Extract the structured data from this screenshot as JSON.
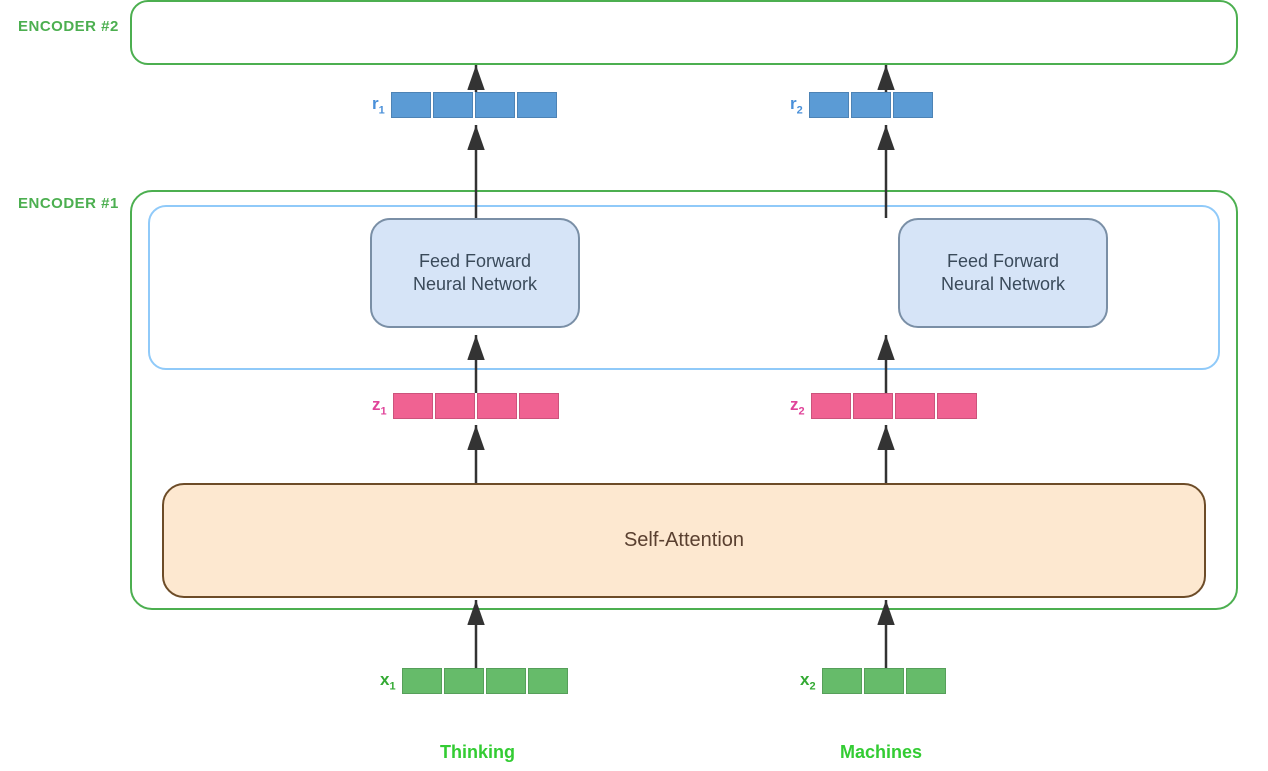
{
  "encoders": {
    "enc2_label": "ENCODER #2",
    "enc1_label": "ENCODER #1"
  },
  "ffnn": {
    "label": "Feed Forward\nNeural Network"
  },
  "self_attention": {
    "label": "Self-Attention"
  },
  "vectors": {
    "r1_label": "r",
    "r1_sub": "1",
    "r2_label": "r",
    "r2_sub": "2",
    "z1_label": "z",
    "z1_sub": "1",
    "z2_label": "z",
    "z2_sub": "2",
    "x1_label": "x",
    "x1_sub": "1",
    "x2_label": "x",
    "x2_sub": "2"
  },
  "words": {
    "thinking": "Thinking",
    "machines": "Machines"
  }
}
